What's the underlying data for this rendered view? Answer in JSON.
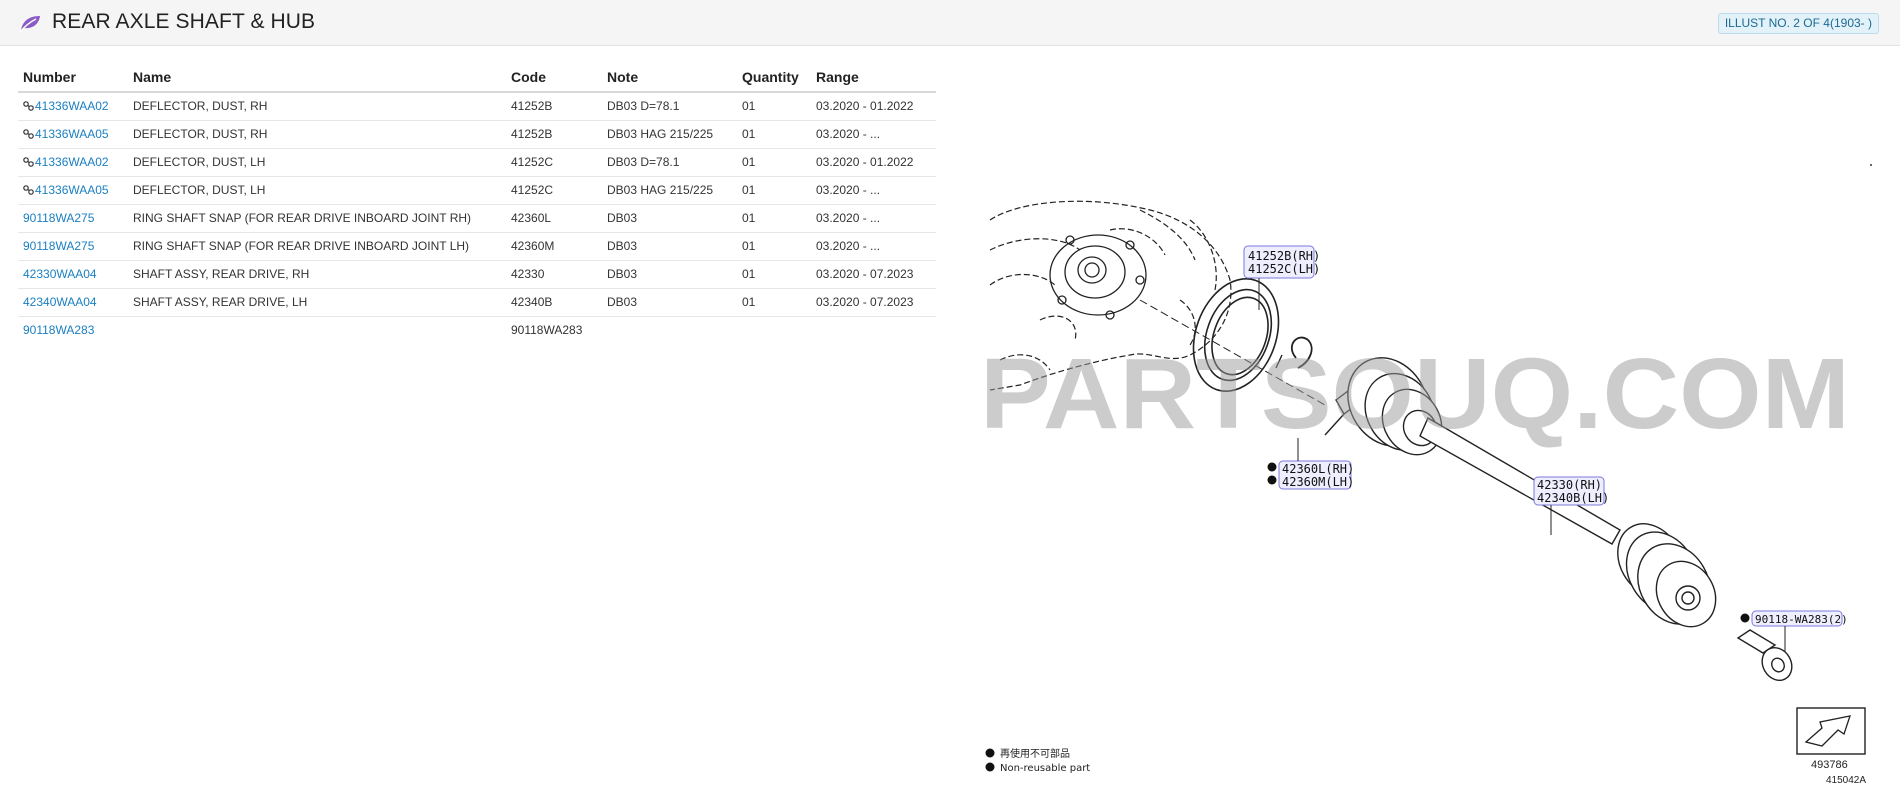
{
  "header": {
    "title": "REAR AXLE SHAFT & HUB",
    "illust_label": "ILLUST NO. 2 OF 4(1903- )",
    "logo_icon": "leaf-icon",
    "accent_color": "#8b5cc7"
  },
  "table": {
    "columns": [
      "Number",
      "Name",
      "Code",
      "Note",
      "Quantity",
      "Range"
    ],
    "rows": [
      {
        "number": "41336WAA02",
        "linked": true,
        "name": "DEFLECTOR, DUST, RH",
        "code": "41252B",
        "note": "DB03 D=78.1",
        "quantity": "01",
        "range": "03.2020 - 01.2022"
      },
      {
        "number": "41336WAA05",
        "linked": true,
        "name": "DEFLECTOR, DUST, RH",
        "code": "41252B",
        "note": "DB03 HAG 215/225",
        "quantity": "01",
        "range": "03.2020 - ..."
      },
      {
        "number": "41336WAA02",
        "linked": true,
        "name": "DEFLECTOR, DUST, LH",
        "code": "41252C",
        "note": "DB03 D=78.1",
        "quantity": "01",
        "range": "03.2020 - 01.2022"
      },
      {
        "number": "41336WAA05",
        "linked": true,
        "name": "DEFLECTOR, DUST, LH",
        "code": "41252C",
        "note": "DB03 HAG 215/225",
        "quantity": "01",
        "range": "03.2020 - ..."
      },
      {
        "number": "90118WA275",
        "linked": false,
        "name": "RING SHAFT SNAP (FOR REAR DRIVE INBOARD JOINT RH)",
        "code": "42360L",
        "note": "DB03",
        "quantity": "01",
        "range": "03.2020 - ..."
      },
      {
        "number": "90118WA275",
        "linked": false,
        "name": "RING SHAFT SNAP (FOR REAR DRIVE INBOARD JOINT LH)",
        "code": "42360M",
        "note": "DB03",
        "quantity": "01",
        "range": "03.2020 - ..."
      },
      {
        "number": "42330WAA04",
        "linked": false,
        "name": "SHAFT ASSY, REAR DRIVE, RH",
        "code": "42330",
        "note": "DB03",
        "quantity": "01",
        "range": "03.2020 - 07.2023"
      },
      {
        "number": "42340WAA04",
        "linked": false,
        "name": "SHAFT ASSY, REAR DRIVE, LH",
        "code": "42340B",
        "note": "DB03",
        "quantity": "01",
        "range": "03.2020 - 07.2023"
      },
      {
        "number": "90118WA283",
        "linked": false,
        "name": "",
        "code": "90118WA283",
        "note": "",
        "quantity": "",
        "range": ""
      }
    ]
  },
  "diagram": {
    "watermark": "PARTSOUQ.COM",
    "callouts": {
      "deflector_rh": "41252B(RH)",
      "deflector_lh": "41252C(LH)",
      "snap_rh": "42360L(RH)",
      "snap_lh": "42360M(LH)",
      "shaft_rh": "42330(RH)",
      "shaft_lh": "42340B(LH)",
      "bolt": "90118-WA283(2)"
    },
    "legend_jp": "再使用不可部品",
    "legend_en": "Non-reusable part",
    "ref_box": "493786",
    "illust_code": "415042A"
  }
}
